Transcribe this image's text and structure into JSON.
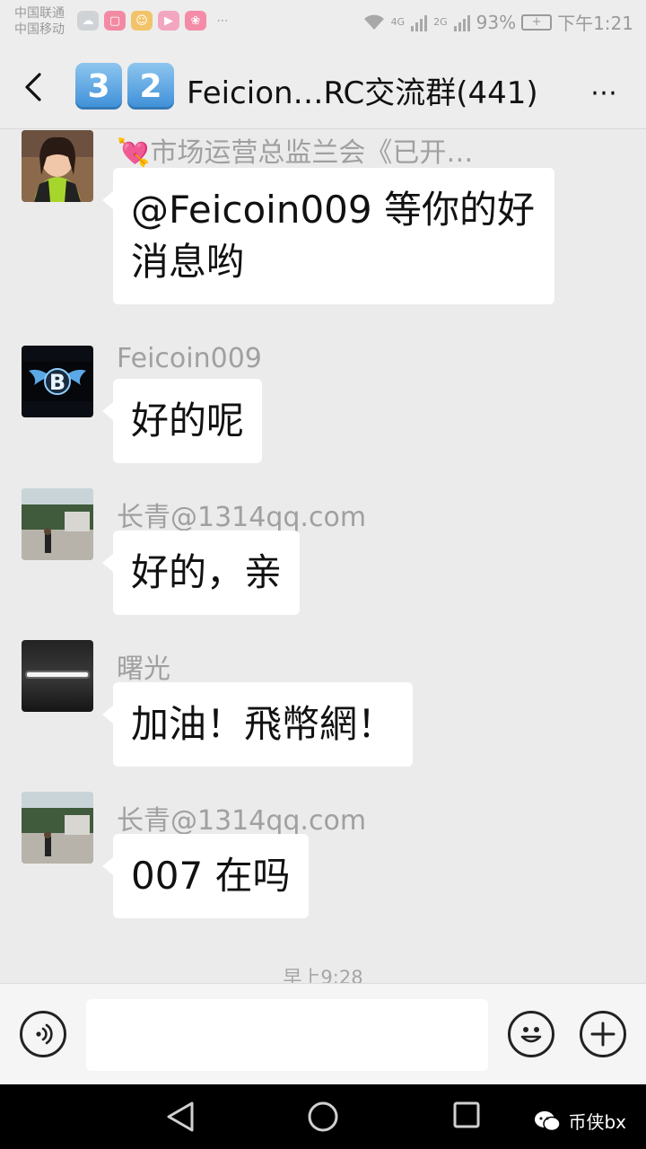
{
  "status_bar": {
    "carrier_1": "中国联通",
    "carrier_2": "中国移动",
    "net_1": "4G",
    "net_2": "2G",
    "battery": "93%",
    "time": "下午1:21"
  },
  "header": {
    "badge_1": "3",
    "badge_2": "2",
    "title": "Feicion…RC交流群(441)",
    "more": "⋯"
  },
  "messages": [
    {
      "sender": "💘市场运营总监兰会《已开…",
      "text_line1": "@Feicoin009 等你的好",
      "text_line2": "消息哟"
    },
    {
      "sender": "Feicoin009",
      "text": "好的呢"
    },
    {
      "sender": "长青@1314qq.com",
      "text": "好的，亲"
    },
    {
      "sender": "曙光",
      "text": "加油！飛幣網！"
    },
    {
      "sender": "长青@1314qq.com",
      "text": "007 在吗"
    }
  ],
  "timestamp": "早上9:28",
  "watermark": "币侠bx",
  "colors": {
    "badge": "#4a9ae0",
    "bubble": "#ffffff",
    "chat_bg": "#ebebeb"
  }
}
